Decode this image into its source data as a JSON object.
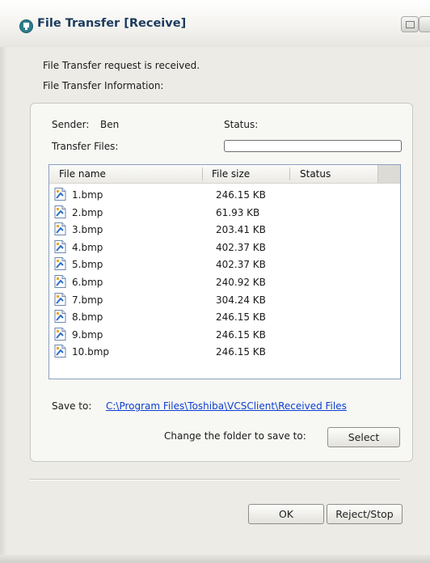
{
  "window": {
    "title": "File Transfer [Receive]"
  },
  "info": {
    "request_text": "File Transfer request is received.",
    "info_label": "File Transfer Information:",
    "sender_label": "Sender:",
    "sender_value": "Ben",
    "status_label": "Status:",
    "transfer_files_label": "Transfer Files:",
    "progress": 0
  },
  "file_list": {
    "columns": [
      "File name",
      "File size",
      "Status"
    ],
    "rows": [
      {
        "name": "1.bmp",
        "size": "246.15 KB",
        "status": ""
      },
      {
        "name": "2.bmp",
        "size": "61.93 KB",
        "status": ""
      },
      {
        "name": "3.bmp",
        "size": "203.41 KB",
        "status": ""
      },
      {
        "name": "4.bmp",
        "size": "402.37 KB",
        "status": ""
      },
      {
        "name": "5.bmp",
        "size": "402.37 KB",
        "status": ""
      },
      {
        "name": "6.bmp",
        "size": "240.92 KB",
        "status": ""
      },
      {
        "name": "7.bmp",
        "size": "304.24 KB",
        "status": ""
      },
      {
        "name": "8.bmp",
        "size": "246.15 KB",
        "status": ""
      },
      {
        "name": "9.bmp",
        "size": "246.15 KB",
        "status": ""
      },
      {
        "name": "10.bmp",
        "size": "246.15 KB",
        "status": ""
      }
    ],
    "icon": "image-file-icon"
  },
  "save": {
    "label": "Save to:",
    "path": "C:\\Program Files\\Toshiba\\VCSClient\\Received Files",
    "change_label": "Change the folder to save to:",
    "select_button": "Select"
  },
  "buttons": {
    "ok": "OK",
    "reject": "Reject/Stop"
  },
  "colors": {
    "link": "#0b3fd0",
    "title": "#1b3b5f",
    "list_border": "#8aa0bf"
  }
}
